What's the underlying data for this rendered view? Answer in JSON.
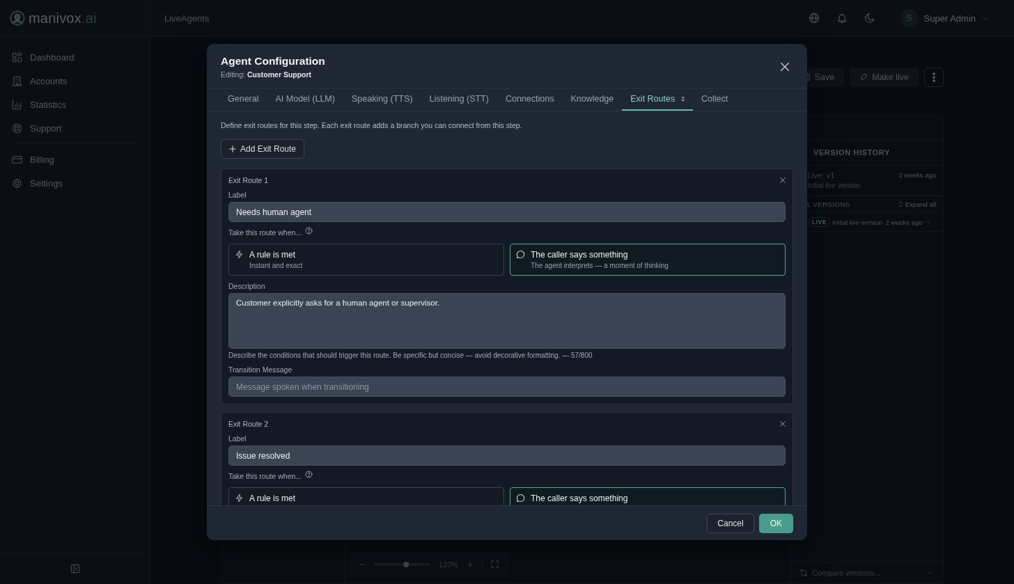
{
  "brand": {
    "name": "manivox",
    "suffix": ".ai"
  },
  "sidebar": {
    "sections": [
      {
        "items": [
          {
            "label": "Dashboard"
          },
          {
            "label": "Accounts"
          },
          {
            "label": "Statistics"
          },
          {
            "label": "Support"
          }
        ]
      },
      {
        "items": [
          {
            "label": "Billing"
          },
          {
            "label": "Settings"
          }
        ]
      }
    ]
  },
  "header": {
    "breadcrumb": "LiveAgents",
    "user": {
      "initial": "S",
      "name": "Super Admin"
    }
  },
  "toolbar": {
    "buttons": [
      "Save",
      "Make live"
    ]
  },
  "version_history": {
    "title": "VERSION HISTORY",
    "live": {
      "name": "Live: v1",
      "note": "Initial live version",
      "time": "2 weeks ago"
    },
    "section": "L VERSIONS",
    "expand": "Expand all",
    "versions": [
      {
        "badge": "LIVE",
        "note": "Initial live version",
        "time": "2 weeks ago"
      }
    ],
    "compare": "Compare versions..."
  },
  "zoom": {
    "reading": "120%",
    "level": 0.57
  },
  "dialog": {
    "title": "Agent Configuration",
    "subtitle": "Editing: **Customer Support**",
    "tabs": [
      {
        "label": "General",
        "selected": false
      },
      {
        "label": "AI Model (LLM)",
        "selected": false
      },
      {
        "label": "Speaking (TTS)",
        "selected": false
      },
      {
        "label": "Listening (STT)",
        "selected": false
      },
      {
        "label": "Connections",
        "selected": false
      },
      {
        "label": "Knowledge",
        "selected": false
      },
      {
        "label": "Exit Routes",
        "badge": "2",
        "selected": true
      },
      {
        "label": "Collect",
        "selected": false
      }
    ],
    "intro": "Define exit routes for this step. Each exit route adds a branch you can connect from this step.",
    "add_button": "Add Exit Route",
    "routes": [
      {
        "title": "Exit Route 1",
        "label_caption": "Label",
        "label_value": "Needs human agent",
        "condition_caption": "Take this route when...",
        "options": [
          {
            "title": "A rule is met",
            "hint": "Instant and exact",
            "selected": false
          },
          {
            "title": "The caller says something",
            "hint": "The agent interprets — a moment of thinking",
            "selected": true
          }
        ],
        "description_caption": "Description",
        "description": "Customer explicitly asks for a human agent or supervisor.",
        "description_hint": "Describe the conditions that should trigger this route. Be specific but concise — avoid decorative formatting. — 57/800",
        "message_caption": "Transition Message",
        "message_placeholder": "Message spoken when transitioning"
      },
      {
        "title": "Exit Route 2",
        "label_caption": "Label",
        "label_value": "Issue resolved",
        "condition_caption": "Take this route when...",
        "options": [
          {
            "title": "A rule is met",
            "selected": false
          },
          {
            "title": "The caller says something",
            "selected": true
          }
        ]
      }
    ],
    "buttons": {
      "cancel": "Cancel",
      "ok": "OK"
    }
  }
}
